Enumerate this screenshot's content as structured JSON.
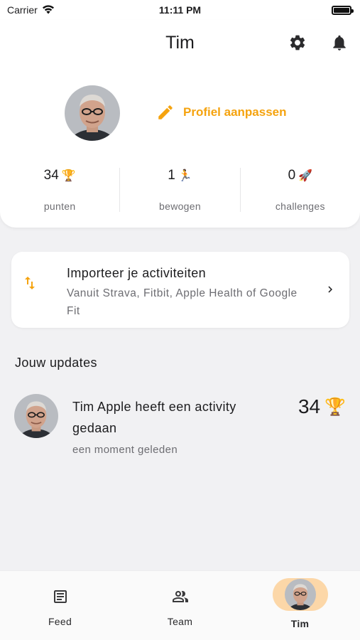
{
  "status_bar": {
    "carrier": "Carrier",
    "time": "11:11 PM"
  },
  "header": {
    "title": "Tim",
    "settings_icon": "gear-icon",
    "notifications_icon": "bell-icon"
  },
  "profile": {
    "avatar": "avatar-photo",
    "edit_label": "Profiel aanpassen",
    "accent_color": "#f5a30f"
  },
  "stats": [
    {
      "value": "34",
      "emoji": "🏆",
      "label": "punten"
    },
    {
      "value": "1",
      "emoji": "🏃",
      "label": "bewogen"
    },
    {
      "value": "0",
      "emoji": "🚀",
      "label": "challenges"
    }
  ],
  "import_card": {
    "title": "Importeer je activiteiten",
    "subtitle": "Vanuit Strava, Fitbit, Apple Health of Google Fit",
    "icon": "swap-vertical-icon"
  },
  "updates": {
    "section_title": "Jouw updates",
    "items": [
      {
        "text": "Tim Apple heeft een activity gedaan",
        "time": "een moment geleden",
        "points": "34",
        "points_emoji": "🏆"
      }
    ]
  },
  "bottom_nav": [
    {
      "label": "Feed",
      "icon": "article-icon"
    },
    {
      "label": "Team",
      "icon": "people-icon"
    },
    {
      "label": "Tim",
      "icon": "avatar"
    }
  ]
}
